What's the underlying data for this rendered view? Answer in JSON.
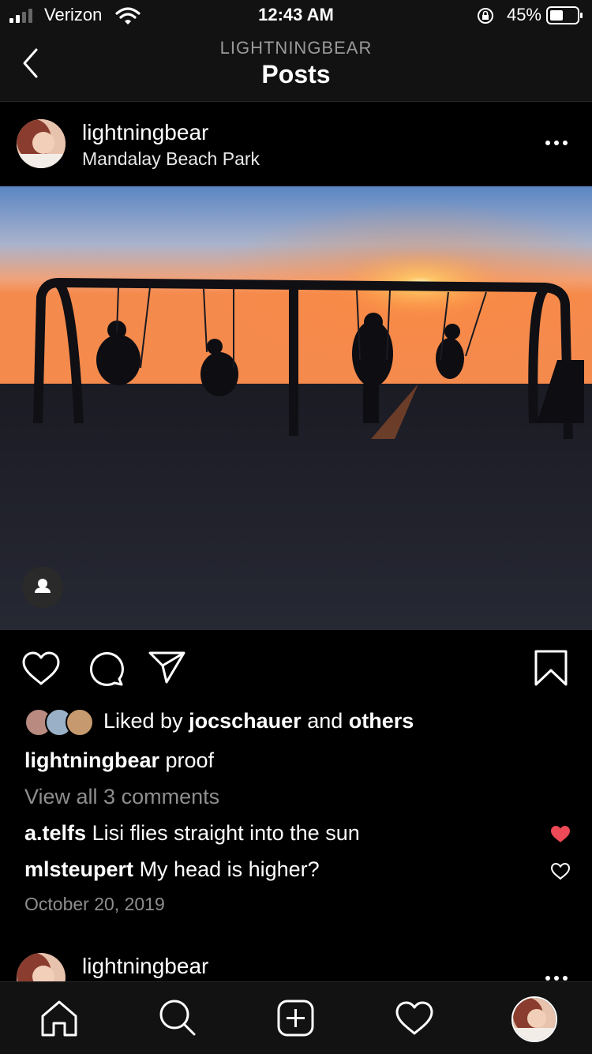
{
  "status_bar": {
    "carrier": "Verizon",
    "time": "12:43 AM",
    "battery": "45%"
  },
  "nav": {
    "subtitle": "LIGHTNINGBEAR",
    "title": "Posts"
  },
  "post": {
    "username": "lightningbear",
    "location": "Mandalay Beach Park",
    "likes": {
      "prefix": "Liked by",
      "user": "jocschauer",
      "and": "and",
      "others": "others"
    },
    "caption_user": "lightningbear",
    "caption": "proof",
    "view_comments": "View all 3 comments",
    "comments": [
      {
        "user": "a.telfs",
        "text": "Lisi flies straight into the sun",
        "liked": true
      },
      {
        "user": "mlsteupert",
        "text": "My head is higher?",
        "liked": false
      }
    ],
    "date": "October 20, 2019"
  },
  "next_post": {
    "username": "lightningbear"
  },
  "colors": {
    "like_red": "#ed4956",
    "muted": "#8e8e8e",
    "bar_bg": "#121212"
  },
  "tabs": [
    "home-icon",
    "search-icon",
    "new-post-icon",
    "activity-icon",
    "profile-avatar"
  ]
}
